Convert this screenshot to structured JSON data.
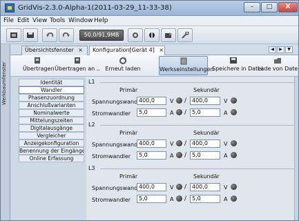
{
  "window": {
    "title": "GridVis-2.3.0-Alpha-1(2011-03-29_11-33-38)",
    "min_label": "–",
    "max_label": "□",
    "close_label": "X"
  },
  "menu": [
    "File",
    "Edit",
    "View",
    "Tools",
    "Window",
    "Help"
  ],
  "toolbar": {
    "zoom_value": "50,0/91,9MB",
    "icons": [
      "open-project-icon",
      "save-icon",
      "undo-icon",
      "redo-icon",
      "memory-icon",
      "online-icon",
      "export-icon",
      "wrench-icon"
    ]
  },
  "sidestrip": {
    "label": "Werkbaumfenster"
  },
  "tabs": [
    {
      "label": "Übersichtsfenster",
      "close": "×"
    },
    {
      "label": "Konfiguration[Gerät 4]",
      "close": "×"
    }
  ],
  "actions": [
    {
      "label": "Übertragen",
      "icon": "transfer-icon"
    },
    {
      "label": "Übertragen an ..",
      "icon": "transfer-to-icon"
    },
    {
      "label": "Erneut laden",
      "icon": "reload-icon"
    },
    {
      "label": "Werkseinstellungen",
      "icon": "factory-settings-icon"
    },
    {
      "label": "Speichere in Datei",
      "icon": "save-file-icon"
    },
    {
      "label": "Lade von Datei",
      "icon": "load-file-icon"
    }
  ],
  "nav": [
    "Identität",
    "Wandler",
    "Phasenzuordnung",
    "Anschlußvarianten",
    "Nominalwerte",
    "Mittelungszeiten",
    "Digitalausgänge",
    "Vergleicher",
    "Anzeigekonfiguration",
    "Benennung der Eingänge",
    "Online Erfassung"
  ],
  "content": {
    "col_primary": "Primär",
    "col_secondary": "Sekundär",
    "voltage_label": "Spannungswandler",
    "current_label": "Stromwandler",
    "unit_v": "V",
    "unit_a": "A",
    "slash": "/",
    "sections": [
      {
        "name": "L1",
        "v_primary": "400,0",
        "v_secondary": "400,0",
        "a_primary": "5,0",
        "a_secondary": "5,0"
      },
      {
        "name": "L2",
        "v_primary": "400,0",
        "v_secondary": "400,0",
        "a_primary": "5,0",
        "a_secondary": "5,0"
      },
      {
        "name": "L3",
        "v_primary": "400,0",
        "v_secondary": "400,0",
        "a_primary": "5,0",
        "a_secondary": "5,0"
      }
    ]
  }
}
